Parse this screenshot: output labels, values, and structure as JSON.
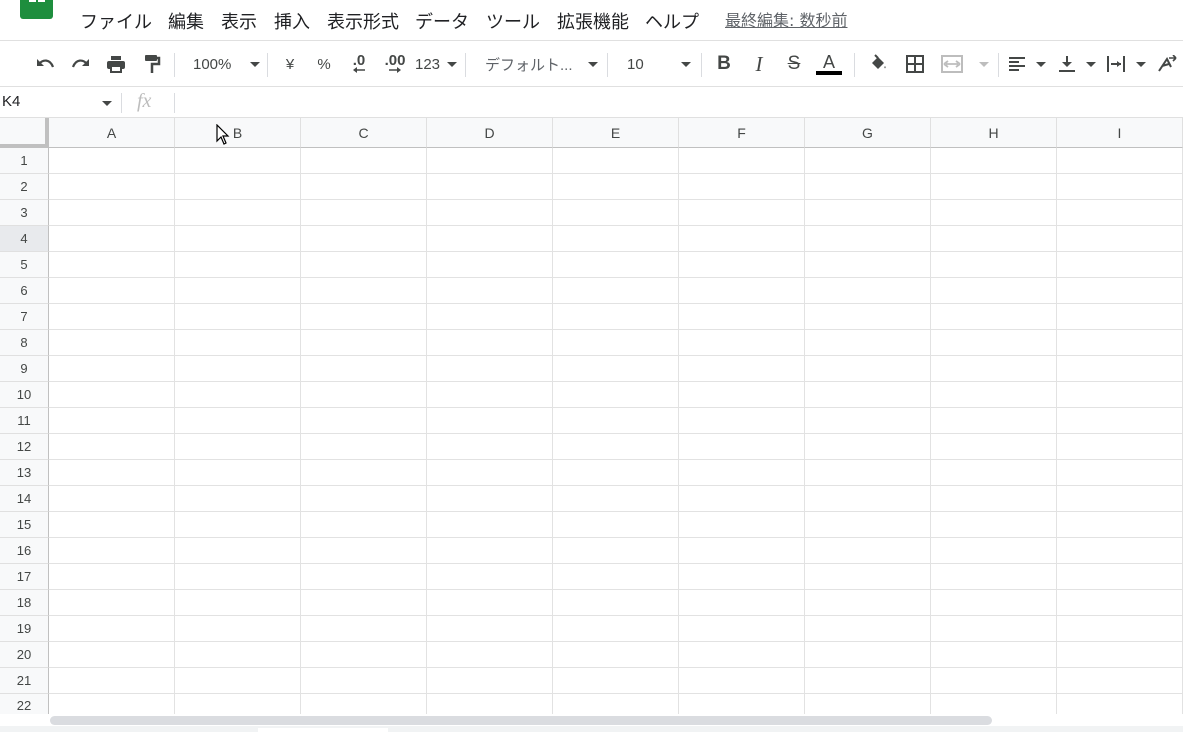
{
  "menubar": {
    "logo": "sheets-logo-icon",
    "items": [
      "ファイル",
      "編集",
      "表示",
      "挿入",
      "表示形式",
      "データ",
      "ツール",
      "拡張機能",
      "ヘルプ"
    ],
    "last_edit": "最終編集: 数秒前"
  },
  "toolbar": {
    "zoom": "100%",
    "currency": "¥",
    "percent": "%",
    "dec_decrease": ".0",
    "dec_increase": ".00",
    "more_formats": "123",
    "font": "デフォルト...",
    "font_size": "10",
    "bold": "B",
    "italic": "I",
    "strike": "S",
    "text_color": "A"
  },
  "formula_bar": {
    "name_box": "K4",
    "fx": "fx",
    "value": ""
  },
  "grid": {
    "columns": [
      "A",
      "B",
      "C",
      "D",
      "E",
      "F",
      "G",
      "H",
      "I"
    ],
    "rows": [
      "1",
      "2",
      "3",
      "4",
      "5",
      "6",
      "7",
      "8",
      "9",
      "10",
      "11",
      "12",
      "13",
      "14",
      "15",
      "16",
      "17",
      "18",
      "19",
      "20",
      "21",
      "22"
    ],
    "active_row": "4"
  },
  "colors": {
    "brand": "#1e8e3e",
    "header_bg": "#f8f9fa",
    "gridline": "#e2e2e2"
  }
}
